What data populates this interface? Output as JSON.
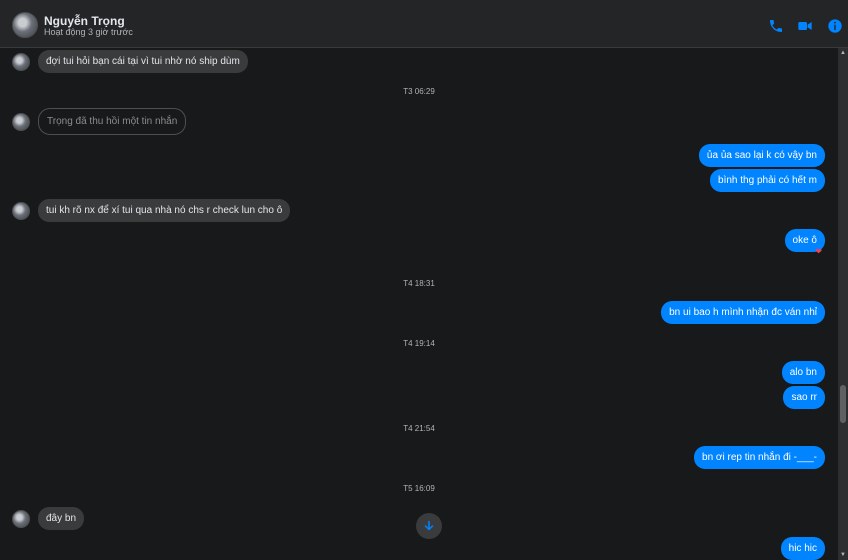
{
  "header": {
    "contact_name": "Nguyễn Trọng",
    "status": "Hoạt động 3 giờ trước",
    "icons": [
      "phone-icon",
      "video-camera-icon",
      "info-icon"
    ],
    "accent_color": "#0084ff"
  },
  "messages": {
    "m1": "đợi tui hỏi bạn cái tại vì tui nhờ nó ship dùm",
    "ts1": "T3 06:29",
    "m2": "Trọng đã thu hồi một tin nhắn",
    "m3": "ủa ủa sao lại k có vậy bn",
    "m4": "bình thg phải có hết m",
    "m5": "tui kh rõ nx để xí tui qua nhà nó chs r check lun cho ô",
    "m6": "oke ô",
    "m6_reaction": "❤",
    "ts2": "T4 18:31",
    "m7": "bn ui bao h mình nhận đc ván nhỉ",
    "ts3": "T4 19:14",
    "m8": "alo bn",
    "m9": "sao rr",
    "ts4": "T4 21:54",
    "m10": "bn ơi rep tin nhắn đi -___-",
    "ts5": "T5 16:09",
    "m11": "đây bn",
    "m12": "hic hic"
  }
}
